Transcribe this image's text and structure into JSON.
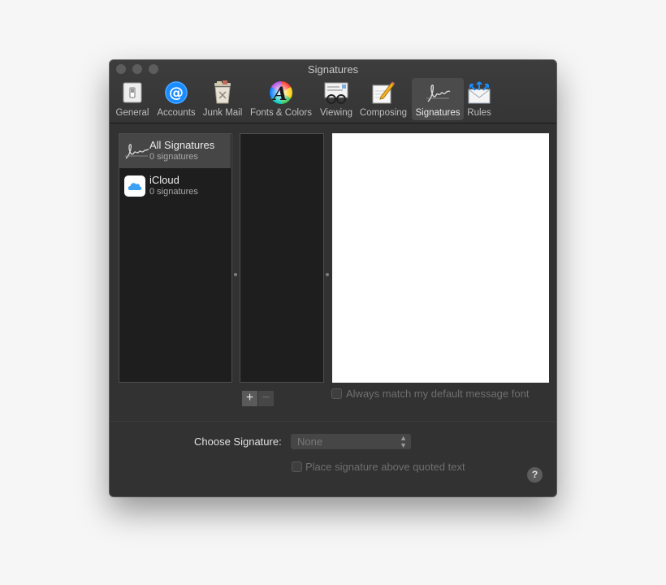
{
  "window": {
    "title": "Signatures"
  },
  "toolbar": {
    "items": [
      {
        "label": "General",
        "icon": "switch-icon"
      },
      {
        "label": "Accounts",
        "icon": "at-sign-icon"
      },
      {
        "label": "Junk Mail",
        "icon": "trash-bin-icon"
      },
      {
        "label": "Fonts & Colors",
        "icon": "color-wheel-icon"
      },
      {
        "label": "Viewing",
        "icon": "glasses-icon"
      },
      {
        "label": "Composing",
        "icon": "pencil-note-icon"
      },
      {
        "label": "Signatures",
        "icon": "signature-icon",
        "active": true
      },
      {
        "label": "Rules",
        "icon": "envelope-arrows-icon"
      }
    ]
  },
  "accounts": [
    {
      "name": "All Signatures",
      "count": "0 signatures",
      "icon": "signature-icon",
      "selected": true
    },
    {
      "name": "iCloud",
      "count": "0 signatures",
      "icon": "icloud-icon"
    }
  ],
  "signature_list": {
    "add_label": "+",
    "remove_label": "−"
  },
  "options": {
    "match_font_label": "Always match my default message font",
    "match_font_checked": false,
    "choose_signature_label": "Choose Signature:",
    "choose_signature_value": "None",
    "place_above_label": "Place signature above quoted text",
    "place_above_checked": false
  },
  "help": {
    "label": "?"
  },
  "colors": {
    "window_bg": "#323232",
    "panel_bg": "#1e1e1e",
    "selection": "#464646",
    "accent_blue": "#1a8cff"
  }
}
